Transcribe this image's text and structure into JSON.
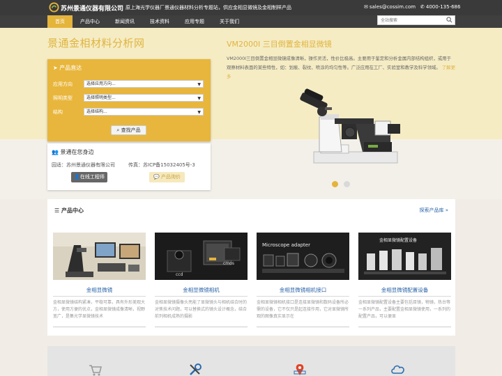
{
  "header": {
    "brand": "苏州景通仪器有限公司",
    "tagline": "原上海光学仪器厂景通仪器材料分析专题站，供应金相显微镜及金相制样产品",
    "email": "sales@cossim.com",
    "phone": "4000-135-686"
  },
  "nav": {
    "items": [
      "首页",
      "产品中心",
      "新闻资讯",
      "技术资料",
      "应用专题",
      "关于我们"
    ],
    "active": "首页"
  },
  "search": {
    "placeholder": "全站搜索"
  },
  "hero": {
    "site_title": "景通金相材料分析网",
    "filter": {
      "title": "产品直达",
      "rows": [
        {
          "label": "应用方向",
          "value": "选择应用方向..."
        },
        {
          "label": "照明类型",
          "value": "选择照明类型..."
        },
        {
          "label": "结构",
          "value": "选择结构..."
        }
      ],
      "button": "查找产品"
    },
    "about": {
      "title": "景通在您身边",
      "company": "园适：苏州景通仪器有限公司",
      "icp": "传真：苏ICP备15032405号-3",
      "engineer_btn": "在线工程师",
      "quote_btn": "产品询价"
    },
    "product": {
      "title": "VM2000I 三目倒置金相显微镜",
      "desc": "VM2000I三目倒置金相显微镜成像清晰，操作灵活，性价比极高。主要用于鉴定和分析金属内部结构组织，或用于观察材料表面的某些特性，如：划痕、裂纹、喷涂的均匀性等。广泛应用在工厂、实验室和教学及科学领域。",
      "more": "了解更多"
    },
    "carousel_active": 0
  },
  "products": {
    "title": "产品中心",
    "link": "探索产品库 »",
    "cards": [
      {
        "title": "金相显微镜",
        "desc": "金相显微镜结构紧凑，平稳可靠，具有外形美观大方，使用方便的优点，金相显微镜成像清晰，视野宽广，是集光学显微镜技术"
      },
      {
        "title": "金相显微镜相机",
        "desc": "金相显微镜摄像头亮能了显微镜头与相机结合时的对焦技术问题，可以替换式的镜头设计概念，结合前列相机成熟的摄影"
      },
      {
        "title": "金相显微镜相机接口",
        "desc": "金相显微镜相机接口是连接显微镜和数码设备所必需的设备，它不仅只是起连接作用，它对显微镜所观的图像真实显示在"
      },
      {
        "title": "金相显微镜配置设备",
        "desc": "金相显微镜配置设备主要包括目镜，物镜，热台等一系列产品，主要配置金相显微镜使用，一系列的配置产品，可以便显"
      }
    ],
    "card2_labels": [
      "ccd",
      "cmos"
    ],
    "card3_label": "Microscope adapter",
    "card4_label": "金相显微镜配置设备"
  }
}
